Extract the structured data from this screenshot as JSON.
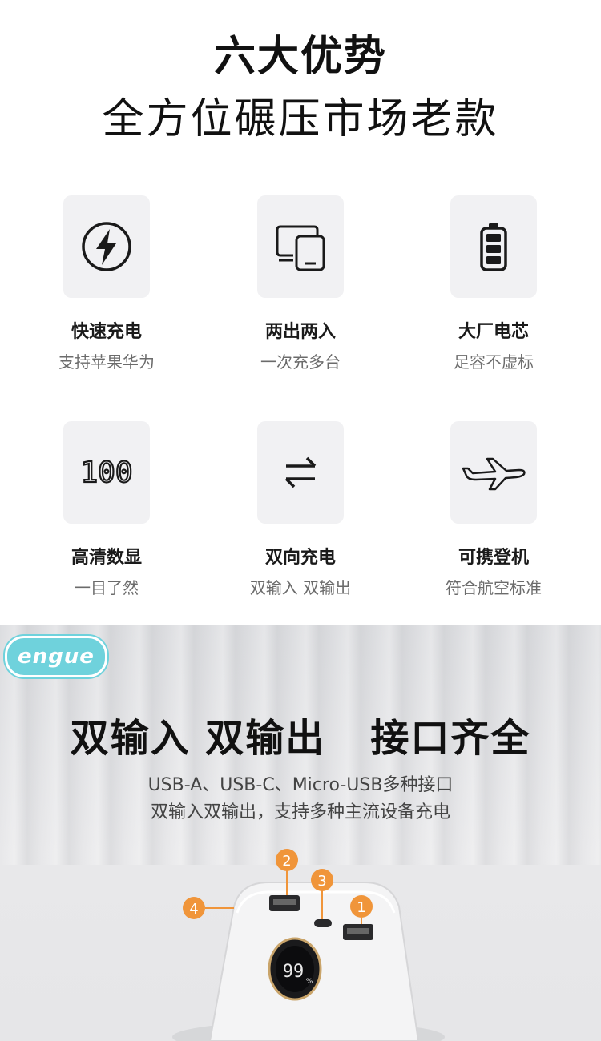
{
  "header": {
    "title": "六大优势",
    "subtitle": "全方位碾压市场老款"
  },
  "features": [
    {
      "icon": "fast-charge-icon",
      "name": "快速充电",
      "sub": "支持苹果华为"
    },
    {
      "icon": "devices-icon",
      "name": "两出两入",
      "sub": "一次充多台"
    },
    {
      "icon": "battery-icon",
      "name": "大厂电芯",
      "sub": "足容不虚标"
    },
    {
      "icon": "digital-display-icon",
      "display_text": "100",
      "name": "高清数显",
      "sub": "一目了然"
    },
    {
      "icon": "swap-arrows-icon",
      "name": "双向充电",
      "sub": "双输入 双输出"
    },
    {
      "icon": "airplane-icon",
      "name": "可携登机",
      "sub": "符合航空标准"
    }
  ],
  "banner": {
    "logo": "engue",
    "title": "双输入 双输出   接口齐全",
    "line1": "USB-A、USB-C、Micro-USB多种接口",
    "line2": "双输入双输出，支持多种主流设备充电"
  },
  "device": {
    "display_value": "99",
    "display_unit": "%",
    "callouts": [
      "2",
      "3",
      "1",
      "4"
    ]
  },
  "colors": {
    "accent_orange": "#f0953a",
    "logo_teal": "#6fd2dc"
  }
}
